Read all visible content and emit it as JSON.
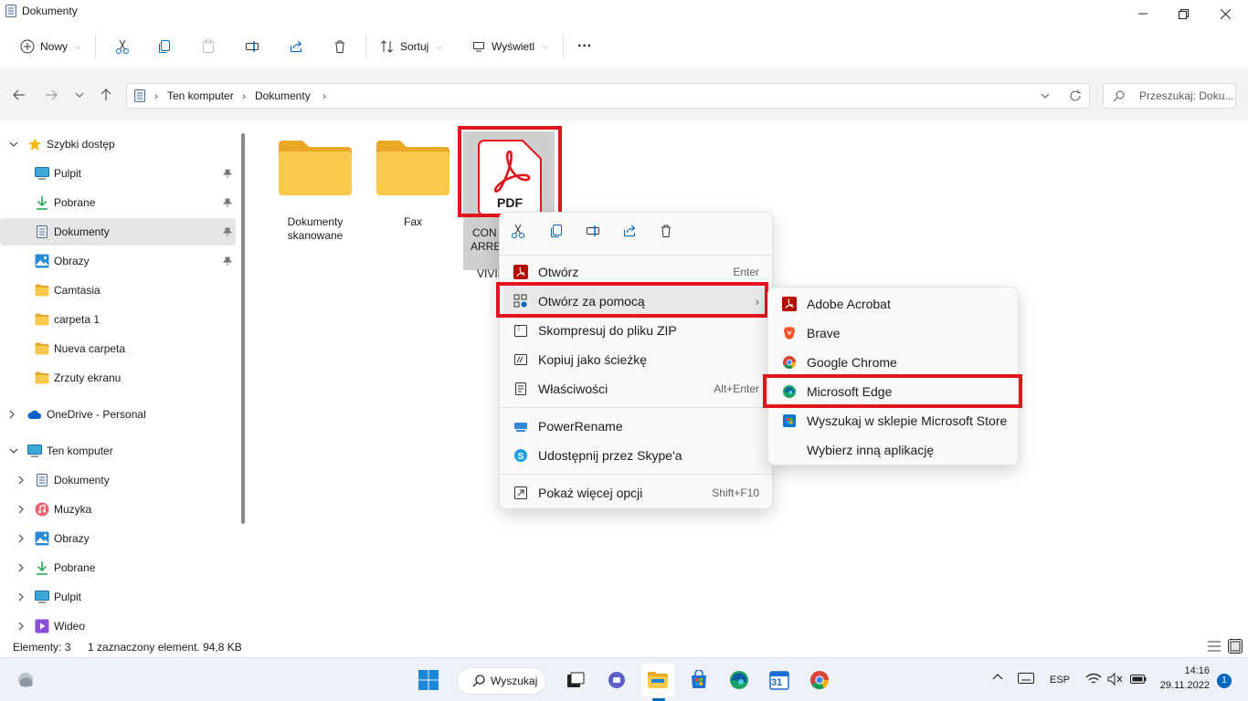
{
  "window": {
    "title": "Dokumenty",
    "icon": "documents-icon"
  },
  "toolbar": {
    "new_label": "Nowy",
    "sort_label": "Sortuj",
    "view_label": "Wyświetl",
    "more_label": "···"
  },
  "address": {
    "crumbs": [
      "Ten komputer",
      "Dokumenty"
    ],
    "search_placeholder": "Przeszukaj: Doku..."
  },
  "sidebar": {
    "quick_access": "Szybki dostęp",
    "quick_items": [
      {
        "label": "Pulpit",
        "icon": "desktop-icon",
        "pinned": true
      },
      {
        "label": "Pobrane",
        "icon": "download-icon",
        "pinned": true
      },
      {
        "label": "Dokumenty",
        "icon": "documents-icon",
        "pinned": true,
        "selected": true
      },
      {
        "label": "Obrazy",
        "icon": "pictures-icon",
        "pinned": true
      },
      {
        "label": "Camtasia",
        "icon": "folder-icon"
      },
      {
        "label": "carpeta 1",
        "icon": "folder-icon"
      },
      {
        "label": "Nueva carpeta",
        "icon": "folder-icon"
      },
      {
        "label": "Zrzuty ekranu",
        "icon": "folder-icon"
      }
    ],
    "onedrive": "OneDrive - Personal",
    "this_pc": "Ten komputer",
    "pc_items": [
      {
        "label": "Dokumenty",
        "icon": "documents-icon"
      },
      {
        "label": "Muzyka",
        "icon": "music-icon"
      },
      {
        "label": "Obrazy",
        "icon": "pictures-icon"
      },
      {
        "label": "Pobrane",
        "icon": "download-icon"
      },
      {
        "label": "Pulpit",
        "icon": "desktop-icon"
      },
      {
        "label": "Wideo",
        "icon": "video-icon"
      }
    ]
  },
  "files": [
    {
      "name_line1": "Dokumenty",
      "name_line2": "skanowane",
      "type": "folder"
    },
    {
      "name_line1": "Fax",
      "name_line2": "",
      "type": "folder"
    },
    {
      "name_line1": "CON",
      "name_line2": "ARREI",
      "name_line3": "VIVII",
      "type": "pdf",
      "selected": true,
      "badge": "PDF"
    }
  ],
  "status": {
    "count": "Elementy: 3",
    "selection": "1 zaznaczony element. 94,8 KB"
  },
  "context_menu": {
    "items": [
      {
        "label": "Otwórz",
        "shortcut": "Enter",
        "icon": "acrobat-icon"
      },
      {
        "label": "Otwórz za pomocą",
        "shortcut": "",
        "icon": "open-with-icon",
        "submenu": true,
        "highlighted": true
      },
      {
        "label": "Skompresuj do pliku ZIP",
        "shortcut": "",
        "icon": "zip-icon"
      },
      {
        "label": "Kopiuj jako ścieżkę",
        "shortcut": "",
        "icon": "copy-path-icon"
      },
      {
        "label": "Właściwości",
        "shortcut": "Alt+Enter",
        "icon": "properties-icon"
      },
      {
        "label": "PowerRename",
        "shortcut": "",
        "icon": "powerrename-icon"
      },
      {
        "label": "Udostępnij przez Skype'a",
        "shortcut": "",
        "icon": "skype-icon"
      },
      {
        "label": "Pokaż więcej opcji",
        "shortcut": "Shift+F10",
        "icon": "more-options-icon"
      }
    ]
  },
  "submenu": {
    "items": [
      {
        "label": "Adobe Acrobat",
        "icon": "acrobat-icon"
      },
      {
        "label": "Brave",
        "icon": "brave-icon"
      },
      {
        "label": "Google Chrome",
        "icon": "chrome-icon"
      },
      {
        "label": "Microsoft Edge",
        "icon": "edge-icon",
        "highlighted": true
      },
      {
        "label": "Wyszukaj w sklepie Microsoft Store",
        "icon": "store-icon"
      },
      {
        "label": "Wybierz inną aplikację",
        "icon": ""
      }
    ]
  },
  "taskbar": {
    "search_label": "Wyszukaj",
    "lang": "ESP",
    "time": "14:16",
    "date": "29.11.2022",
    "notifications": "1",
    "calendar_day": "31"
  },
  "colors": {
    "highlight_red": "#e2141c",
    "folder_yellow": "#f8c94a",
    "pdf_red": "#e2141c",
    "accent_blue": "#0067c0"
  }
}
